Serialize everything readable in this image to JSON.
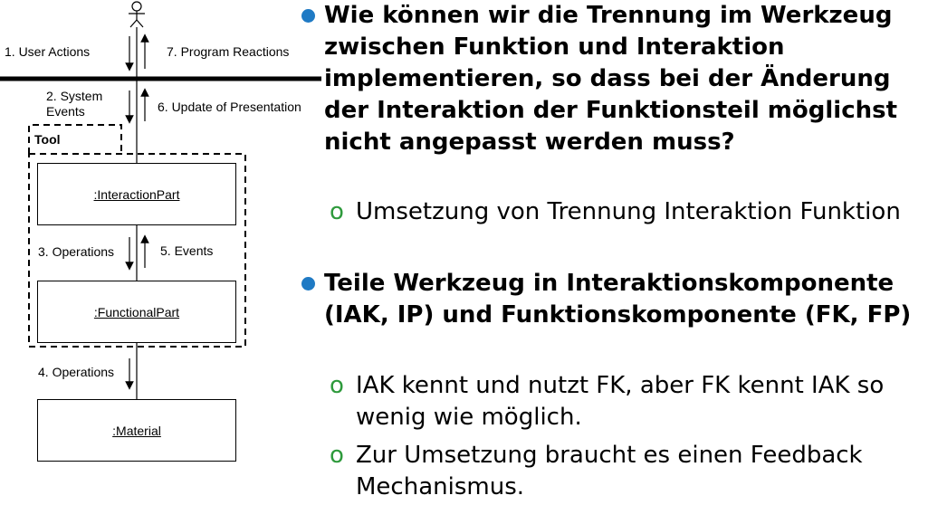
{
  "diagram": {
    "labels": {
      "user_actions": "1. User Actions",
      "program_reactions": "7. Program Reactions",
      "system_events": "2. System Events",
      "update_presentation": "6. Update of Presentation",
      "operations_3": "3. Operations",
      "events_5": "5. Events",
      "operations_4": "4. Operations"
    },
    "tool_label": "Tool",
    "boxes": {
      "interaction_part": ":InteractionPart",
      "functional_part": ":FunctionalPart",
      "material": ":Material"
    }
  },
  "content": {
    "bullets": [
      {
        "text": "Wie können wir die Trennung im Werkzeug zwischen Funktion und Interaktion implementieren, so dass bei der Änderung der Interaktion der Funktionsteil möglichst nicht angepasst werden muss?",
        "subs": [
          "Umsetzung von Trennung Interaktion Funktion"
        ]
      },
      {
        "text": "Teile Werkzeug in Interaktionskomponente (IAK, IP) und Funktionskomponente (FK, FP)",
        "subs": [
          "IAK kennt und nutzt FK, aber FK kennt IAK so wenig wie möglich.",
          "Zur Umsetzung braucht es einen Feedback Mechanismus."
        ]
      }
    ],
    "sub_marker": "o"
  },
  "colors": {
    "bullet": "#1f7ac4",
    "sub_marker": "#2e9a3c"
  }
}
